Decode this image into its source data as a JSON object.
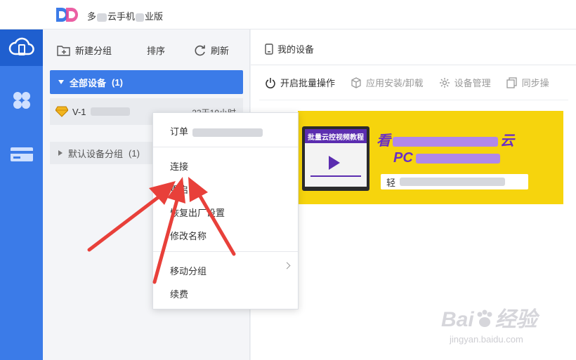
{
  "app": {
    "title_a": "多",
    "title_b": "云手机",
    "title_c": "业版"
  },
  "left_toolbar": {
    "new_group": "新建分组",
    "sort": "排序",
    "refresh": "刷新"
  },
  "groups": {
    "all": {
      "label": "全部设备",
      "count": "(1)"
    },
    "default": {
      "label": "默认设备分组",
      "count": "(1)"
    }
  },
  "device": {
    "name": "V-1",
    "time": "23天10小时"
  },
  "right": {
    "title": "我的设备",
    "actions": [
      "开启批量操作",
      "应用安装/卸载",
      "设备管理",
      "同步操"
    ]
  },
  "banner": {
    "laptop_text": "批量云控视频教程",
    "line1": "看",
    "line1_end": "云",
    "line2": "PC",
    "strip": "轻"
  },
  "context_menu": {
    "items": [
      "订单",
      "连接",
      "重启",
      "恢复出厂设置",
      "修改名称",
      "移动分组",
      "续费"
    ]
  },
  "watermark": {
    "main": "Bai",
    "main2": "经验",
    "sub": "jingyan.baidu.com"
  },
  "colors": {
    "accent": "#3b7be8",
    "arrow": "#e8403a",
    "banner_bg": "#f6d40d"
  }
}
